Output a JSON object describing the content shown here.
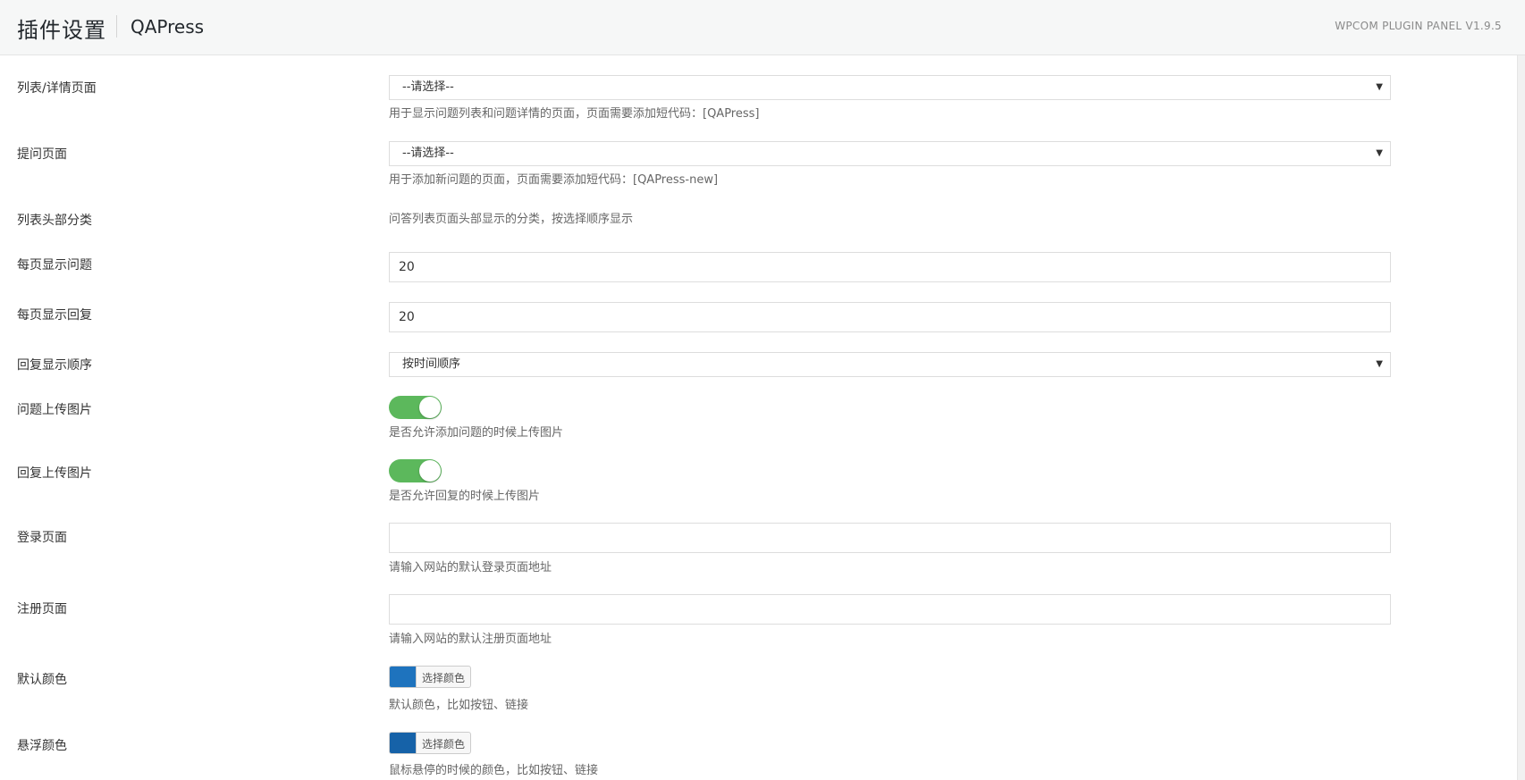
{
  "header": {
    "title": "插件设置",
    "plugin_name": "QAPress",
    "version": "WPCOM PLUGIN PANEL V1.9.5"
  },
  "fields": {
    "list_page": {
      "label": "列表/详情页面",
      "value": "--请选择--",
      "desc": "用于显示问题列表和问题详情的页面，页面需要添加短代码：[QAPress]"
    },
    "ask_page": {
      "label": "提问页面",
      "value": "--请选择--",
      "desc": "用于添加新问题的页面，页面需要添加短代码：[QAPress-new]"
    },
    "list_cats": {
      "label": "列表头部分类",
      "desc": "问答列表页面头部显示的分类，按选择顺序显示"
    },
    "per_page_questions": {
      "label": "每页显示问题",
      "value": "20"
    },
    "per_page_replies": {
      "label": "每页显示回复",
      "value": "20"
    },
    "reply_order": {
      "label": "回复显示顺序",
      "value": "按时间顺序"
    },
    "question_upload": {
      "label": "问题上传图片",
      "enabled": true,
      "desc": "是否允许添加问题的时候上传图片"
    },
    "reply_upload": {
      "label": "回复上传图片",
      "enabled": true,
      "desc": "是否允许回复的时候上传图片"
    },
    "login_page": {
      "label": "登录页面",
      "value": "",
      "desc": "请输入网站的默认登录页面地址"
    },
    "register_page": {
      "label": "注册页面",
      "value": "",
      "desc": "请输入网站的默认注册页面地址"
    },
    "default_color": {
      "label": "默认颜色",
      "button": "选择颜色",
      "color": "#1e73be",
      "desc": "默认颜色，比如按钮、链接"
    },
    "hover_color": {
      "label": "悬浮颜色",
      "button": "选择颜色",
      "color": "#1662a8",
      "desc": "鼠标悬停的时候的颜色，比如按钮、链接"
    }
  },
  "icons": {
    "select_arrow": "▼"
  },
  "colors": {
    "toggle_on": "#5cb85c"
  }
}
